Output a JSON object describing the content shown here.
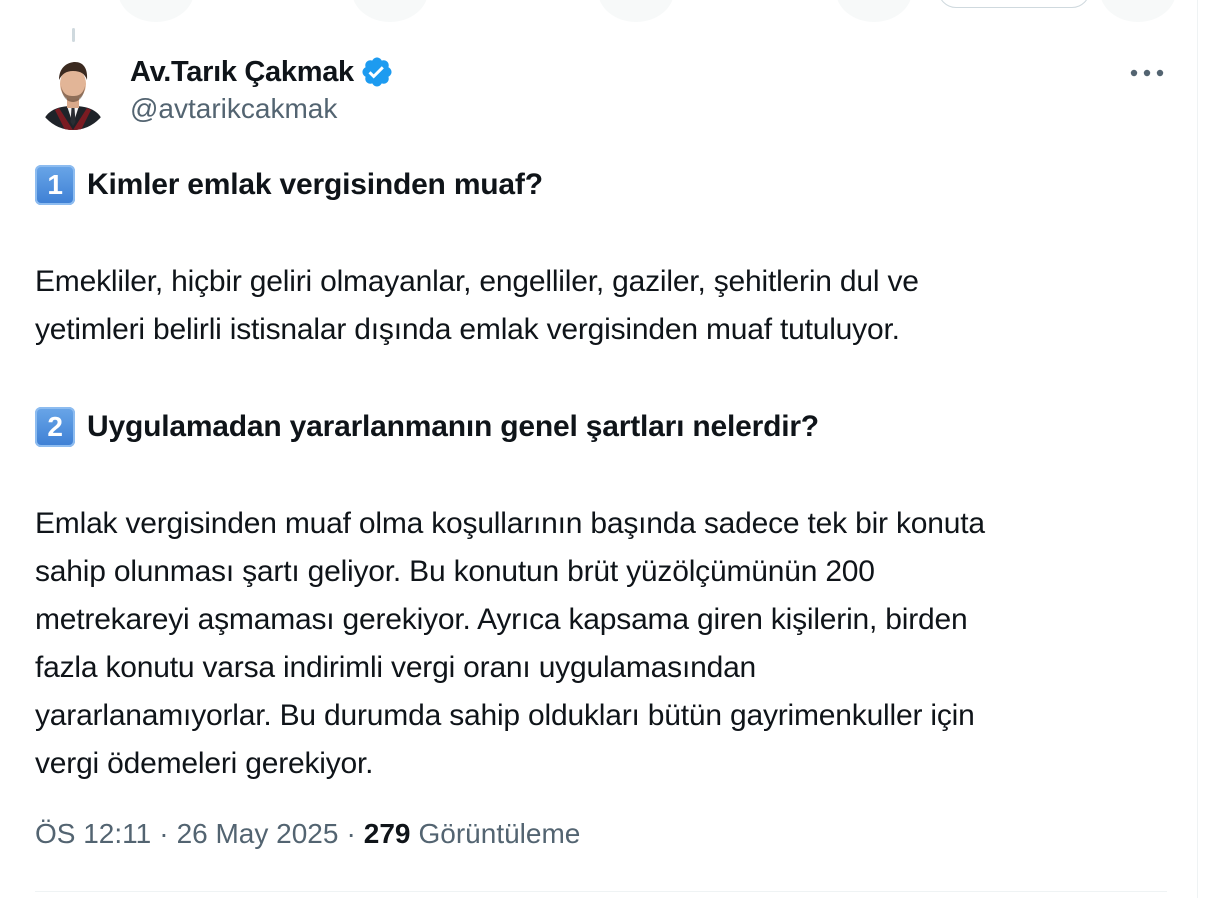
{
  "author": {
    "display_name": "Av.Tarık Çakmak",
    "handle": "@avtarikcakmak",
    "verified": true
  },
  "tweet": {
    "section1_number": "1",
    "section1_heading": "Kimler emlak vergisinden muaf?",
    "section1_text_line1": "Emekliler, hiçbir geliri olmayanlar, engelliler, gaziler, şehitlerin dul ve",
    "section1_text_line2": "yetimleri belirli istisnalar dışında emlak vergisinden muaf tutuluyor.",
    "section2_number": "2",
    "section2_heading": "Uygulamadan yararlanmanın genel şartları nelerdir?",
    "section2_lines": [
      "Emlak vergisinden muaf olma koşullarının başında sadece tek bir konuta",
      "sahip olunması şartı geliyor. Bu konutun brüt yüzölçümünün 200",
      "metrekareyi aşmaması gerekiyor. Ayrıca kapsama giren kişilerin, birden",
      "fazla konutu varsa indirimli vergi oranı uygulamasından",
      "yararlanamıyorlar. Bu durumda sahip oldukları bütün gayrimenkuller için",
      "vergi ödemeleri gerekiyor."
    ]
  },
  "meta": {
    "time": "ÖS 12:11",
    "separator": "·",
    "date": "26 May 2025",
    "views_count": "279",
    "views_label": "Görüntüleme"
  },
  "colors": {
    "text_primary": "#0f1419",
    "text_secondary": "#536471",
    "verified_blue": "#1d9bf0",
    "keycap_blue": "#4a8ddc",
    "divider": "#eff3f4"
  },
  "icons": {
    "verified": "verified-badge-icon",
    "more": "more-options-icon"
  }
}
